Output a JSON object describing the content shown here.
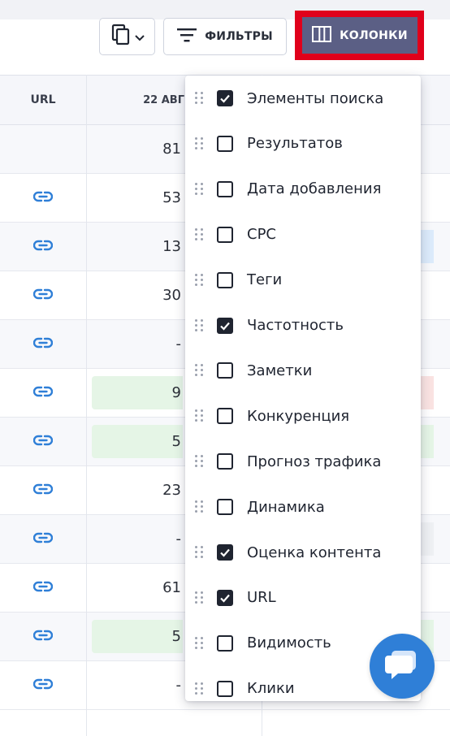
{
  "toolbar": {
    "filters_label": "ФИЛЬТРЫ",
    "columns_label": "КОЛОНКИ"
  },
  "table": {
    "headers": {
      "url": "URL",
      "date": "22 АВГ"
    },
    "rows": [
      {
        "value": "81",
        "has_link": false
      },
      {
        "value": "53",
        "has_link": true
      },
      {
        "value": "13",
        "has_link": true
      },
      {
        "value": "30",
        "has_link": true
      },
      {
        "value": "-",
        "has_link": true
      },
      {
        "value": "9",
        "has_link": true
      },
      {
        "value": "5",
        "has_link": true
      },
      {
        "value": "23",
        "has_link": true
      },
      {
        "value": "-",
        "has_link": true
      },
      {
        "value": "61",
        "has_link": true
      },
      {
        "value": "5",
        "has_link": true
      },
      {
        "value": "-",
        "has_link": true
      }
    ],
    "last_row_right_value": "-"
  },
  "columns_menu": {
    "options": [
      {
        "label": "Элементы поиска",
        "checked": true
      },
      {
        "label": "Результатов",
        "checked": false
      },
      {
        "label": "Дата добавления",
        "checked": false
      },
      {
        "label": "CPC",
        "checked": false
      },
      {
        "label": "Теги",
        "checked": false
      },
      {
        "label": "Частотность",
        "checked": true
      },
      {
        "label": "Заметки",
        "checked": false
      },
      {
        "label": "Конкуренция",
        "checked": false
      },
      {
        "label": "Прогноз трафика",
        "checked": false
      },
      {
        "label": "Динамика",
        "checked": false
      },
      {
        "label": "Оценка контента",
        "checked": true
      },
      {
        "label": "URL",
        "checked": true
      },
      {
        "label": "Видимость",
        "checked": false
      },
      {
        "label": "Клики",
        "checked": false
      }
    ]
  },
  "colors": {
    "accent": "#5b5f85",
    "highlight": "#e0001b",
    "chat": "#2f7fd7",
    "link": "#2f7fd7"
  }
}
